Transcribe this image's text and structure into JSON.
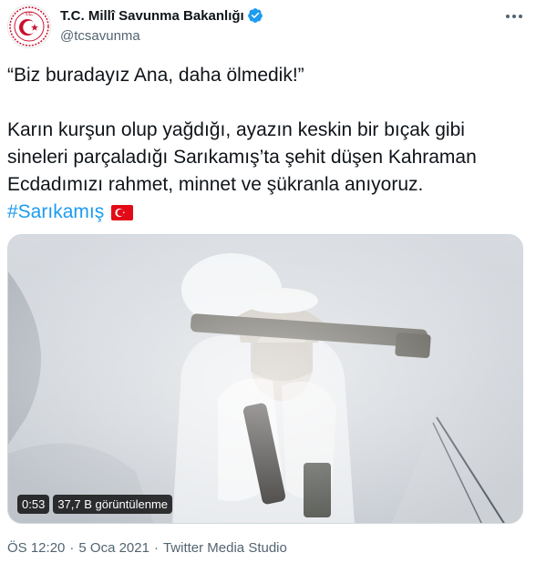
{
  "account": {
    "display_name": "T.C. Millî Savunma Bakanlığı",
    "handle": "@tcsavunma",
    "verified": true
  },
  "tweet": {
    "quote_line": "“Biz buradayız Ana, daha ölmedik!”",
    "body_line_1": "Karın kurşun olup yağdığı, ayazın keskin bir bıçak gibi",
    "body_line_2": "sineleri parçaladığı Sarıkamış’ta şehit düşen Kahraman",
    "body_line_3": "Ecdadımızı rahmet, minnet ve şükranla anıyoruz.",
    "hashtag": "#Sarıkamış",
    "emoji": "turkey-flag-icon"
  },
  "media": {
    "type": "video",
    "duration": "0:53",
    "views": "37,7 B görüntülenme"
  },
  "meta": {
    "time": "ÖS 12:20",
    "separator_1": "·",
    "date": "5 Oca 2021",
    "separator_2": "·",
    "source": "Twitter Media Studio"
  },
  "colors": {
    "accent": "#1d9bf0",
    "text": "#0f1419",
    "muted": "#536471",
    "flag_red": "#e30a17",
    "emblem_red": "#c8102e"
  }
}
